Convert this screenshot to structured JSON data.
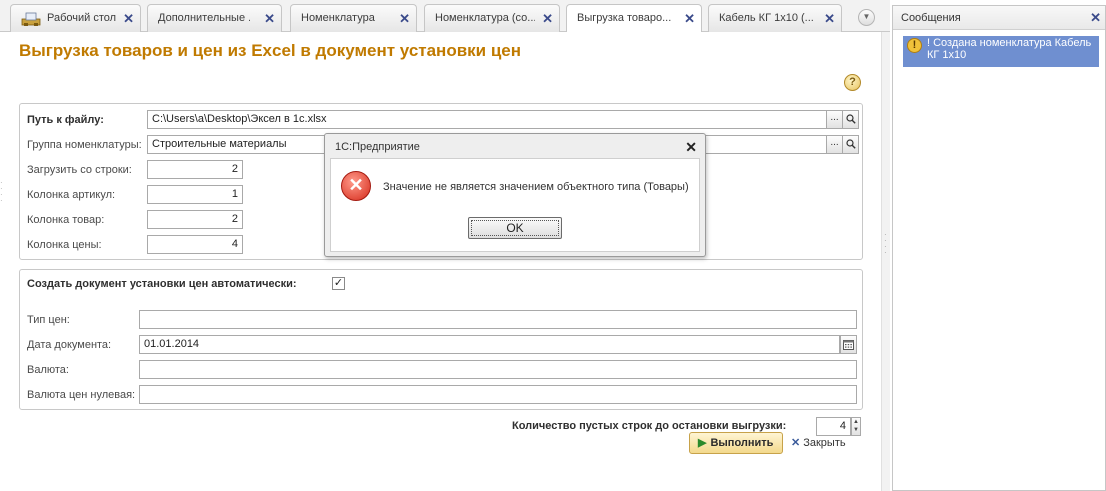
{
  "tabs": [
    {
      "label": "Рабочий стол"
    },
    {
      "label": "Дополнительные ..."
    },
    {
      "label": "Номенклатура"
    },
    {
      "label": "Номенклатура (со..."
    },
    {
      "label": "Выгрузка товаро..."
    },
    {
      "label": "Кабель КГ 1x10 (..."
    }
  ],
  "form": {
    "title": "Выгрузка товаров и цен из Excel в документ установки цен",
    "help": "?",
    "group1": {
      "path_label": "Путь к файлу:",
      "path_value": "C:\\Users\\a\\Desktop\\Эксел в 1с.xlsx",
      "group_label": "Группа номенклатуры:",
      "group_value": "Строительные материалы",
      "start_row_label": "Загрузить со строки:",
      "start_row_value": "2",
      "col_article_label": "Колонка артикул:",
      "col_article_value": "1",
      "col_goods_label": "Колонка товар:",
      "col_goods_value": "2",
      "col_price_label": "Колонка цены:",
      "col_price_value": "4",
      "ellipsis": "...",
      "search_glyph": "🔍"
    },
    "group2": {
      "auto_doc_label": "Создать документ установки цен автоматически:",
      "auto_doc_checked": "✓",
      "price_type_label": "Тип цен:",
      "price_type_value": "",
      "doc_date_label": "Дата документа:",
      "doc_date_value": "01.01.2014",
      "currency_label": "Валюта:",
      "currency_value": "",
      "zero_currency_label": "Валюта цен нулевая:",
      "zero_currency_value": ""
    },
    "empty_rows_label": "Количество пустых строк до остановки выгрузки:",
    "empty_rows_value": "4",
    "run_label": "Выполнить",
    "close_label": "Закрыть"
  },
  "messages": {
    "title": "Сообщения",
    "items": [
      {
        "text": "! Создана номенклатура Кабель КГ 1x10"
      }
    ]
  },
  "dialog": {
    "title": "1С:Предприятие",
    "text": "Значение не является значением объектного типа (Товары)",
    "ok_label": "OK"
  },
  "colors": {
    "title": "#c07a00",
    "message_highlight": "#6f8fd0",
    "error": "#d52a1a"
  }
}
